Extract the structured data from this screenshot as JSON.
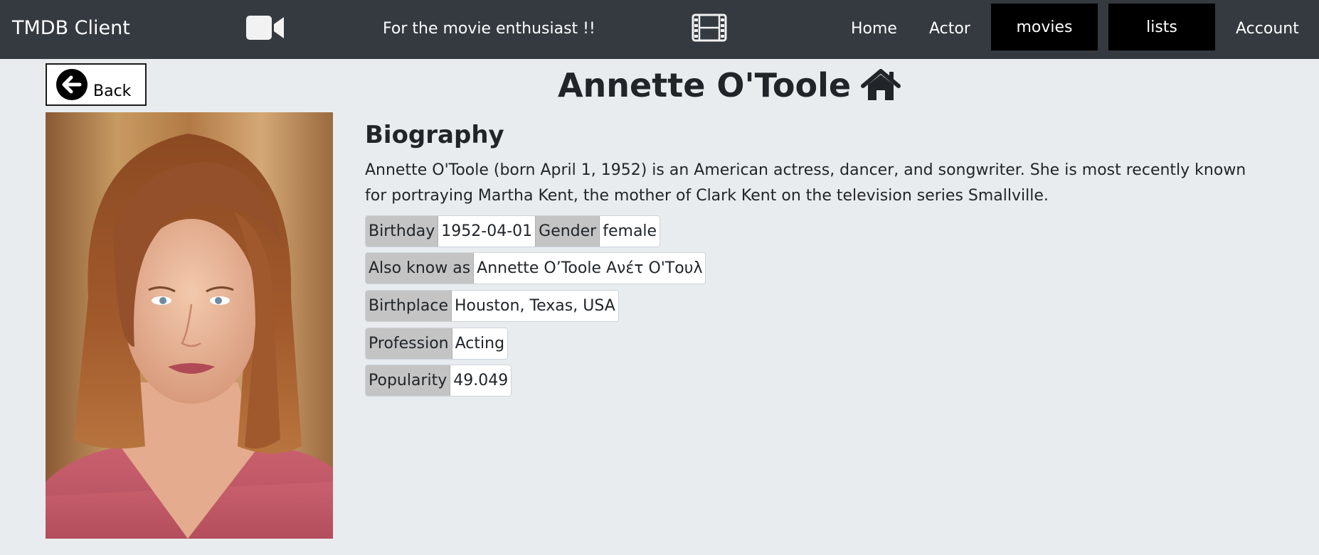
{
  "nav": {
    "brand": "TMDB Client",
    "tagline": "For the movie enthusiast !!",
    "home": "Home",
    "actor": "Actor",
    "movies": "movies",
    "lists": "lists",
    "account": "Account",
    "icons": [
      "video-camera-icon",
      "film-strip-icon"
    ]
  },
  "back_button": {
    "label": "Back",
    "icon": "arrow-left-circle-icon"
  },
  "person": {
    "name": "Annette O'Toole",
    "title_icon": "home-icon",
    "biography_heading": "Biography",
    "biography": "Annette O'Toole (born April 1, 1952) is an American actress, dancer, and songwriter. She is most recently known for portraying Martha Kent, the mother of Clark Kent on the television series Smallville.",
    "details": {
      "birthday_label": "Birthday",
      "birthday": "1952-04-01",
      "gender_label": "Gender",
      "gender": "female",
      "aka_label": "Also know as",
      "aka": "Annette O’Toole Ανέτ Ο'Τουλ",
      "birthplace_label": "Birthplace",
      "birthplace": "Houston, Texas, USA",
      "profession_label": "Profession",
      "profession": "Acting",
      "popularity_label": "Popularity",
      "popularity": "49.049"
    }
  },
  "colors": {
    "navbar": "#343a40",
    "page_background": "#e9ecef",
    "active_button": "#000000",
    "label_chip": "#c4c4c4"
  }
}
